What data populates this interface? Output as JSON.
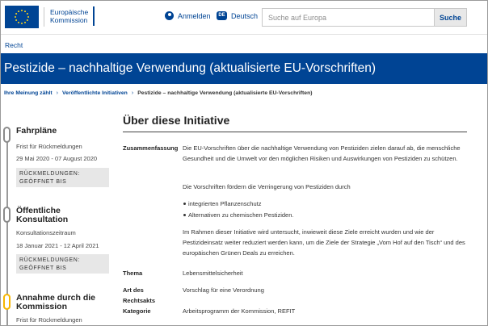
{
  "header": {
    "logo_line1": "Europäische",
    "logo_line2": "Kommission",
    "login_label": "Anmelden",
    "lang_code": "DE",
    "lang_label": "Deutsch",
    "search_placeholder": "Suche auf Europa",
    "search_button": "Suche"
  },
  "site_section": "Recht",
  "page_title": "Pestizide – nachhaltige Verwendung (aktualisierte EU-Vorschriften)",
  "breadcrumb": [
    "Ihre Meinung zählt",
    "Veröffentlichte Initiativen",
    "Pestizide – nachhaltige Verwendung (aktualisierte EU-Vorschriften)"
  ],
  "timeline": [
    {
      "title": "Fahrpläne",
      "sub": "Frist für Rückmeldungen",
      "date": "29 Mai 2020 - 07 August 2020",
      "status_line1": "RÜCKMELDUNGEN:",
      "status_line2": "GEÖFFNET BIS"
    },
    {
      "title_line1": "Öffentliche",
      "title_line2": "Konsultation",
      "sub": "Konsultationszeitraum",
      "date": "18 Januar 2021 - 12 April 2021",
      "status_line1": "RÜCKMELDUNGEN:",
      "status_line2": "GEÖFFNET BIS"
    },
    {
      "title_line1": "Annahme durch die",
      "title_line2": "Kommission",
      "sub": "Frist für Rückmeldungen"
    }
  ],
  "main": {
    "section_title": "Über diese Initiative",
    "summary_label": "Zusammenfassung",
    "summary_p1": "Die EU-Vorschriften über die nachhaltige Verwendung von Pestiziden zielen darauf ab, die menschliche Gesundheit und die Umwelt vor den möglichen Risiken und Auswirkungen von Pestiziden zu schützen.",
    "summary_p2": "Die Vorschriften fördern die Verringerung von Pestiziden durch",
    "bullets": [
      "integrierten Pflanzenschutz",
      "Alternativen zu chemischen Pestiziden."
    ],
    "summary_p3": "Im Rahmen dieser Initiative wird untersucht, inwieweit diese Ziele erreicht wurden und wie der Pestizideinsatz weiter reduziert werden kann, um die Ziele der Strategie „Vom Hof auf den Tisch“ und des europäischen Grünen Deals zu erreichen.",
    "thema_label": "Thema",
    "thema_value": "Lebensmittelsicherheit",
    "art_label_line1": "Art des",
    "art_label_line2": "Rechtsakts",
    "art_value": "Vorschlag für eine Verordnung",
    "kategorie_label": "Kategorie",
    "kategorie_value": "Arbeitsprogramm der Kommission, REFIT"
  },
  "colors": {
    "brand_blue": "#004494",
    "accent_yellow": "#f7b600"
  }
}
